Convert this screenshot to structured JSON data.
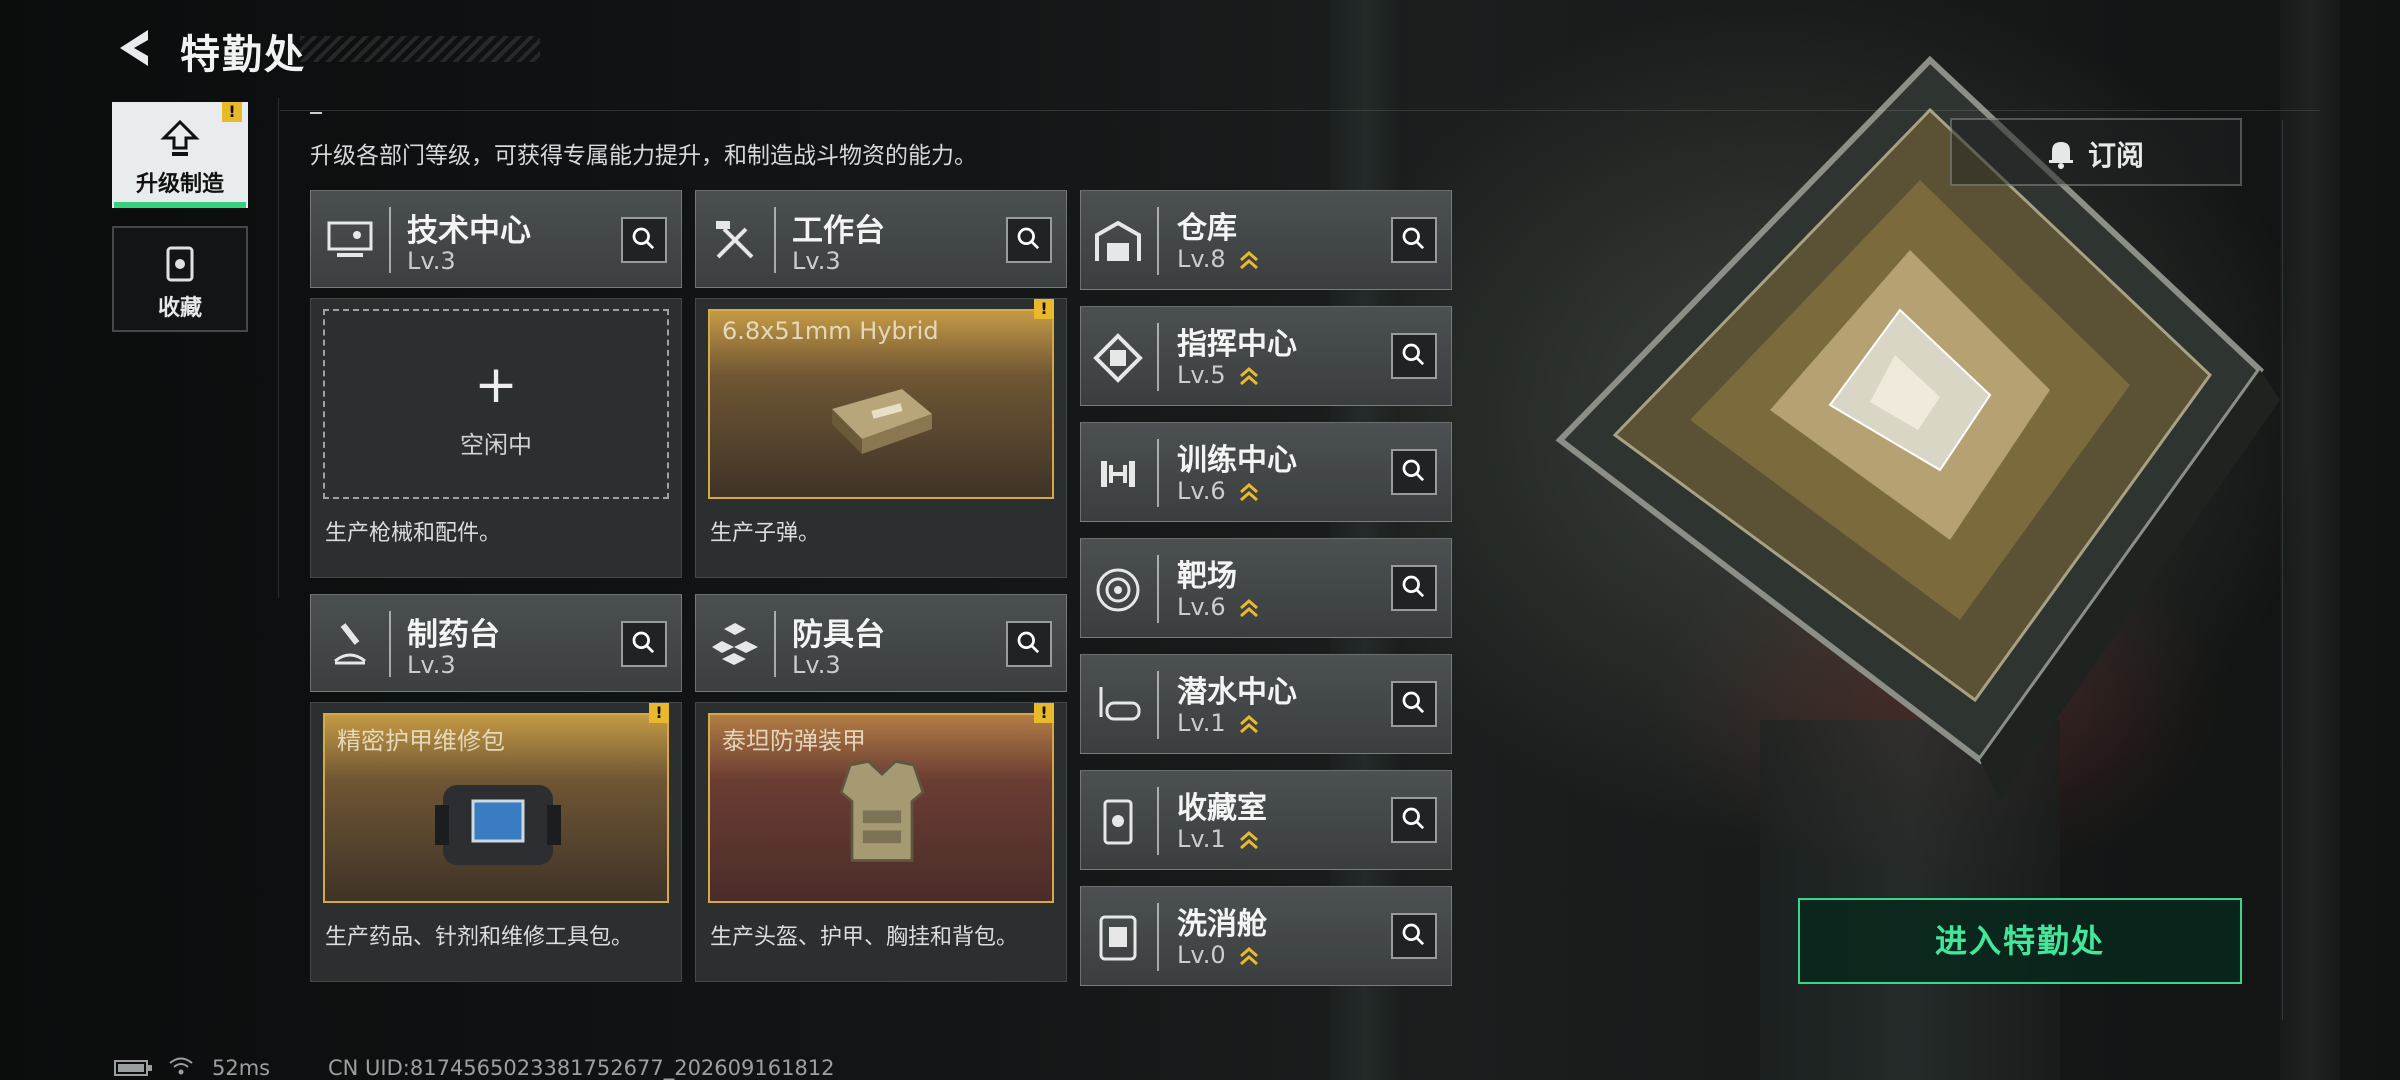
{
  "header": {
    "title": "特勤处"
  },
  "nav": {
    "tabs": [
      {
        "label": "升级制造",
        "icon": "upgrade-icon",
        "badge": "!"
      },
      {
        "label": "收藏",
        "icon": "collection-icon"
      }
    ]
  },
  "subtitle": "升级各部门等级，可获得专属能力提升，和制造战斗物资的能力。",
  "cards": [
    {
      "name": "技术中心",
      "level": "Lv.3",
      "icon": "tech-center-icon",
      "slot_state": "empty",
      "plus": "+",
      "idle": "空闲中",
      "desc": "生产枪械和配件。"
    },
    {
      "name": "工作台",
      "level": "Lv.3",
      "icon": "workbench-icon",
      "slot_state": "producing",
      "item": "6.8x51mm Hybrid",
      "badge": "!",
      "desc": "生产子弹。"
    },
    {
      "name": "制药台",
      "level": "Lv.3",
      "icon": "pharmacy-icon",
      "slot_state": "producing",
      "item": "精密护甲维修包",
      "badge": "!",
      "desc": "生产药品、针剂和维修工具包。"
    },
    {
      "name": "防具台",
      "level": "Lv.3",
      "icon": "armor-bench-icon",
      "slot_state": "producing",
      "item": "泰坦防弹装甲",
      "badge": "!",
      "desc": "生产头盔、护甲、胸挂和背包。"
    }
  ],
  "rooms": [
    {
      "name": "仓库",
      "level": "Lv.8",
      "icon": "warehouse-icon"
    },
    {
      "name": "指挥中心",
      "level": "Lv.5",
      "icon": "command-center-icon"
    },
    {
      "name": "训练中心",
      "level": "Lv.6",
      "icon": "training-center-icon"
    },
    {
      "name": "靶场",
      "level": "Lv.6",
      "icon": "shooting-range-icon"
    },
    {
      "name": "潜水中心",
      "level": "Lv.1",
      "icon": "diving-center-icon"
    },
    {
      "name": "收藏室",
      "level": "Lv.1",
      "icon": "collection-room-icon"
    },
    {
      "name": "洗消舱",
      "level": "Lv.0",
      "icon": "decon-chamber-icon"
    }
  ],
  "subscribe": {
    "label": "订阅"
  },
  "enter": {
    "label": "进入特勤处"
  },
  "status": {
    "ping": "52ms",
    "uid": "CN UID:8174565023381752677_202609161812"
  },
  "colors": {
    "accent_green": "#39d58a",
    "badge_yellow": "#e8b92a",
    "upgrade_chevron": "#e8b92a"
  }
}
